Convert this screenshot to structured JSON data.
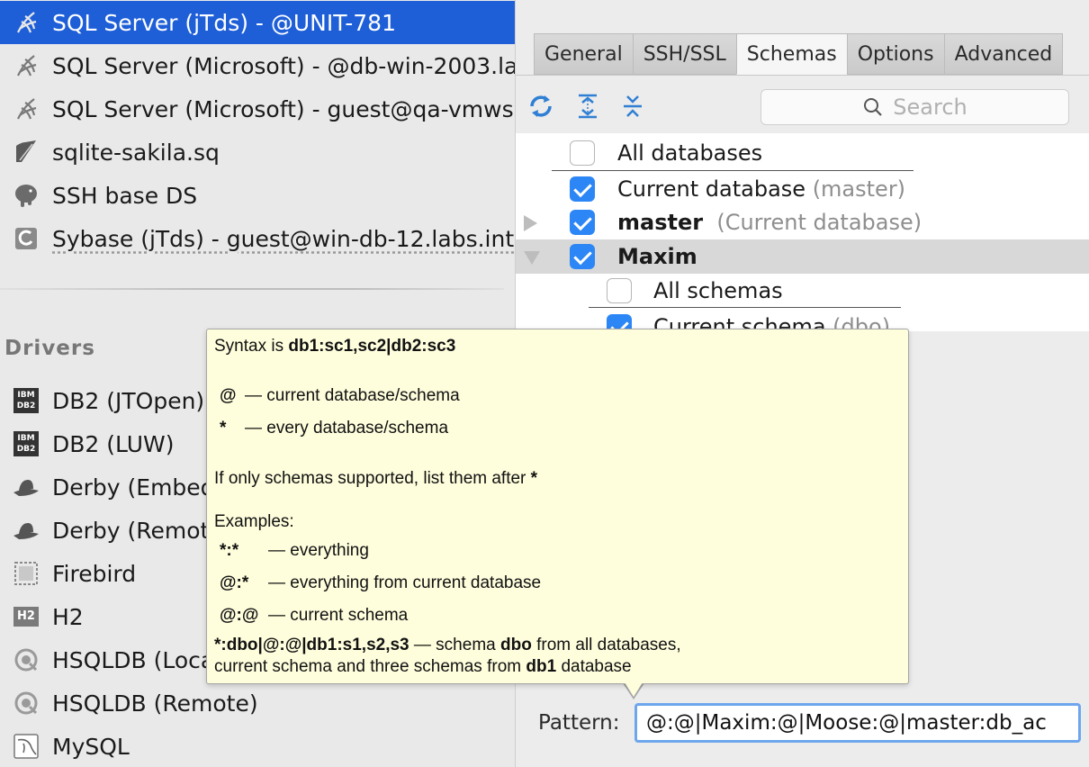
{
  "datasources": [
    {
      "label": "SQL Server (jTds) - @UNIT-781",
      "icon": "sql-server-icon",
      "selected": true
    },
    {
      "label": "SQL Server (Microsoft) - @db-win-2003.la",
      "icon": "sql-server-icon"
    },
    {
      "label": "SQL Server (Microsoft) - guest@qa-vmws",
      "icon": "sql-server-icon"
    },
    {
      "label": "sqlite-sakila.sq",
      "icon": "sqlite-icon"
    },
    {
      "label": "SSH base DS",
      "icon": "postgres-icon"
    },
    {
      "label": "Sybase (jTds) - guest@win-db-12.labs.int",
      "icon": "sybase-icon"
    }
  ],
  "drivers": {
    "title": "Drivers",
    "items": [
      {
        "label": "DB2 (JTOpen)",
        "icon": "db2-icon",
        "badge_top": "IBM",
        "badge_bottom": "DB2"
      },
      {
        "label": "DB2 (LUW)",
        "icon": "db2-icon",
        "badge_top": "IBM",
        "badge_bottom": "DB2"
      },
      {
        "label": "Derby (Embed",
        "icon": "derby-hat-icon"
      },
      {
        "label": "Derby (Remote",
        "icon": "derby-hat-icon"
      },
      {
        "label": "Firebird",
        "icon": "firebird-icon"
      },
      {
        "label": "H2",
        "icon": "h2-icon",
        "badge_top": "H2"
      },
      {
        "label": "HSQLDB (Loca",
        "icon": "hsqldb-icon"
      },
      {
        "label": "HSQLDB (Remote)",
        "icon": "hsqldb-icon"
      },
      {
        "label": "MySQL",
        "icon": "mysql-icon"
      }
    ]
  },
  "tabs": [
    {
      "label": "General"
    },
    {
      "label": "SSH/SSL"
    },
    {
      "label": "Schemas",
      "active": true
    },
    {
      "label": "Options"
    },
    {
      "label": "Advanced"
    }
  ],
  "toolbar": {
    "refresh_icon": "refresh-icon",
    "expand_icon": "expand-all-icon",
    "collapse_icon": "collapse-all-icon"
  },
  "search": {
    "placeholder": "Search"
  },
  "tree": {
    "all_databases": "All databases",
    "current_database": "Current database",
    "current_database_note": "(master)",
    "master": "master",
    "master_note": "(Current database)",
    "maxim": "Maxim",
    "all_schemas": "All schemas",
    "current_schema": "Current schema",
    "current_schema_note": "(dbo)"
  },
  "tooltip": {
    "syntax_prefix": "Syntax is",
    "syntax": "db1:sc1,sc2|db2:sc3",
    "at_sym": "@",
    "at_desc": "— current database/schema",
    "star_sym": "*",
    "star_desc": "— every database/schema",
    "schemas_note": "If only schemas supported, list them after",
    "schemas_note_sym": "*",
    "examples_title": "Examples:",
    "ex1_sym": "*:*",
    "ex1_desc": "— everything",
    "ex2_sym": "@:*",
    "ex2_desc": "— everything from current database",
    "ex3_sym": "@:@",
    "ex3_desc": "— current schema",
    "ex4_sym": "*:dbo|@:@|db1:s1,s2,s3",
    "ex4_desc_a": "— schema",
    "ex4_dbo": "dbo",
    "ex4_desc_b": "from all databases,",
    "ex4_line2_a": "current schema and three schemas from",
    "ex4_db1": "db1",
    "ex4_line2_b": "database"
  },
  "pattern": {
    "label": "Pattern:",
    "value": "@:@|Maxim:@|Moose:@|master:db_ac"
  },
  "colors": {
    "selection": "#1e5fd8",
    "checkbox": "#2d86f5",
    "tooltip_bg": "#fefddc",
    "focus_ring": "#6ea6ee"
  }
}
